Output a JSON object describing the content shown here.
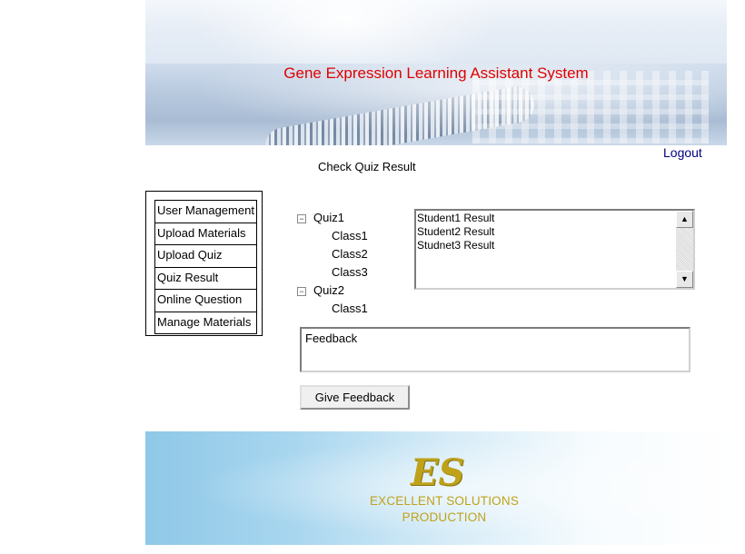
{
  "site": {
    "title": "Gene Expression Learning Assistant System",
    "logout": "Logout"
  },
  "page": {
    "heading": "Check Quiz Result"
  },
  "sidebar": {
    "items": [
      {
        "label": "User Management"
      },
      {
        "label": "Upload Materials"
      },
      {
        "label": "Upload Quiz"
      },
      {
        "label": "Quiz Result"
      },
      {
        "label": "Online Question"
      },
      {
        "label": "Manage Materials"
      }
    ]
  },
  "tree": {
    "toggle_symbol": "−",
    "quizzes": [
      {
        "label": "Quiz1",
        "expanded": true,
        "classes": [
          "Class1",
          "Class2",
          "Class3"
        ]
      },
      {
        "label": "Quiz2",
        "expanded": true,
        "classes": [
          "Class1"
        ]
      }
    ]
  },
  "results": {
    "items": [
      "Student1 Result",
      "Student2 Result",
      "Studnet3 Result"
    ],
    "scroll_up_symbol": "▲",
    "scroll_down_symbol": "▼"
  },
  "feedback": {
    "value": "Feedback",
    "button_label": "Give Feedback"
  },
  "footer": {
    "logo_mark": "ES",
    "logo_line1": "EXCELLENT SOLUTIONS",
    "logo_line2": "PRODUCTION"
  },
  "colors": {
    "title": "#e00000",
    "logout": "#000080",
    "logo": "#bfa21a"
  }
}
